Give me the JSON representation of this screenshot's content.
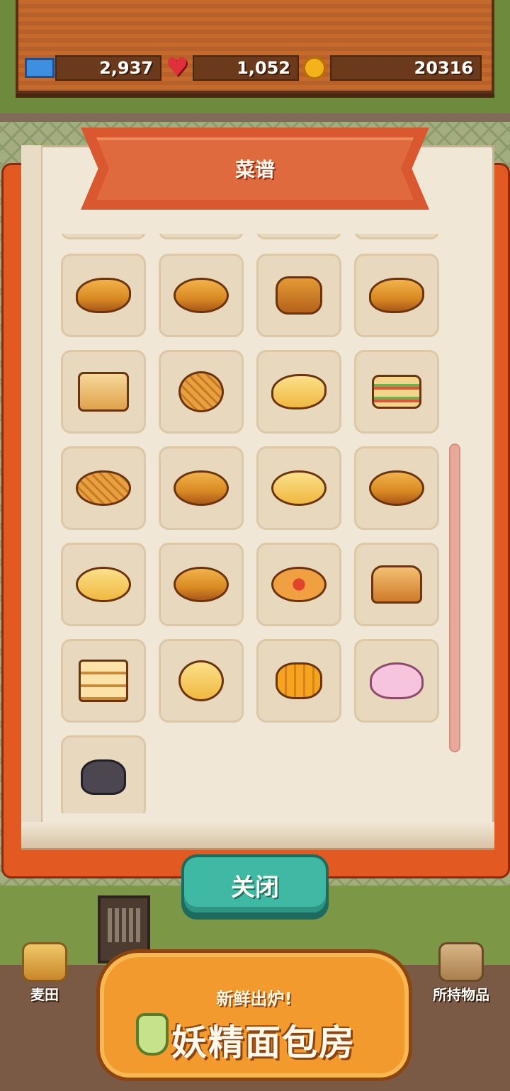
{
  "resources": {
    "tickets": "2,937",
    "hearts": "1,052",
    "coins": "20316",
    "icons": [
      "ticket-icon",
      "heart-icon",
      "coin-icon"
    ]
  },
  "book": {
    "title": "菜谱",
    "recipes": [
      "croissant",
      "oval-loaf",
      "bear-bread",
      "cream-roll",
      "toast-egg",
      "melon-bun",
      "crescent-bun",
      "sandwich",
      "waffle-bread",
      "long-loaf",
      "butter-bun",
      "custard-bun",
      "sugar-bun",
      "round-loaf",
      "pizza-bread",
      "bundt-cake",
      "sliced-bread",
      "round-bun",
      "pumpkin-bread",
      "pink-slime-bread",
      "cat-witch-bread"
    ]
  },
  "close_button": "关闭",
  "bottom_nav": {
    "left_label": "麦田",
    "right_label": "所持物品"
  },
  "logo": {
    "tagline": "新鲜出炉!",
    "title": "妖精面包房"
  }
}
